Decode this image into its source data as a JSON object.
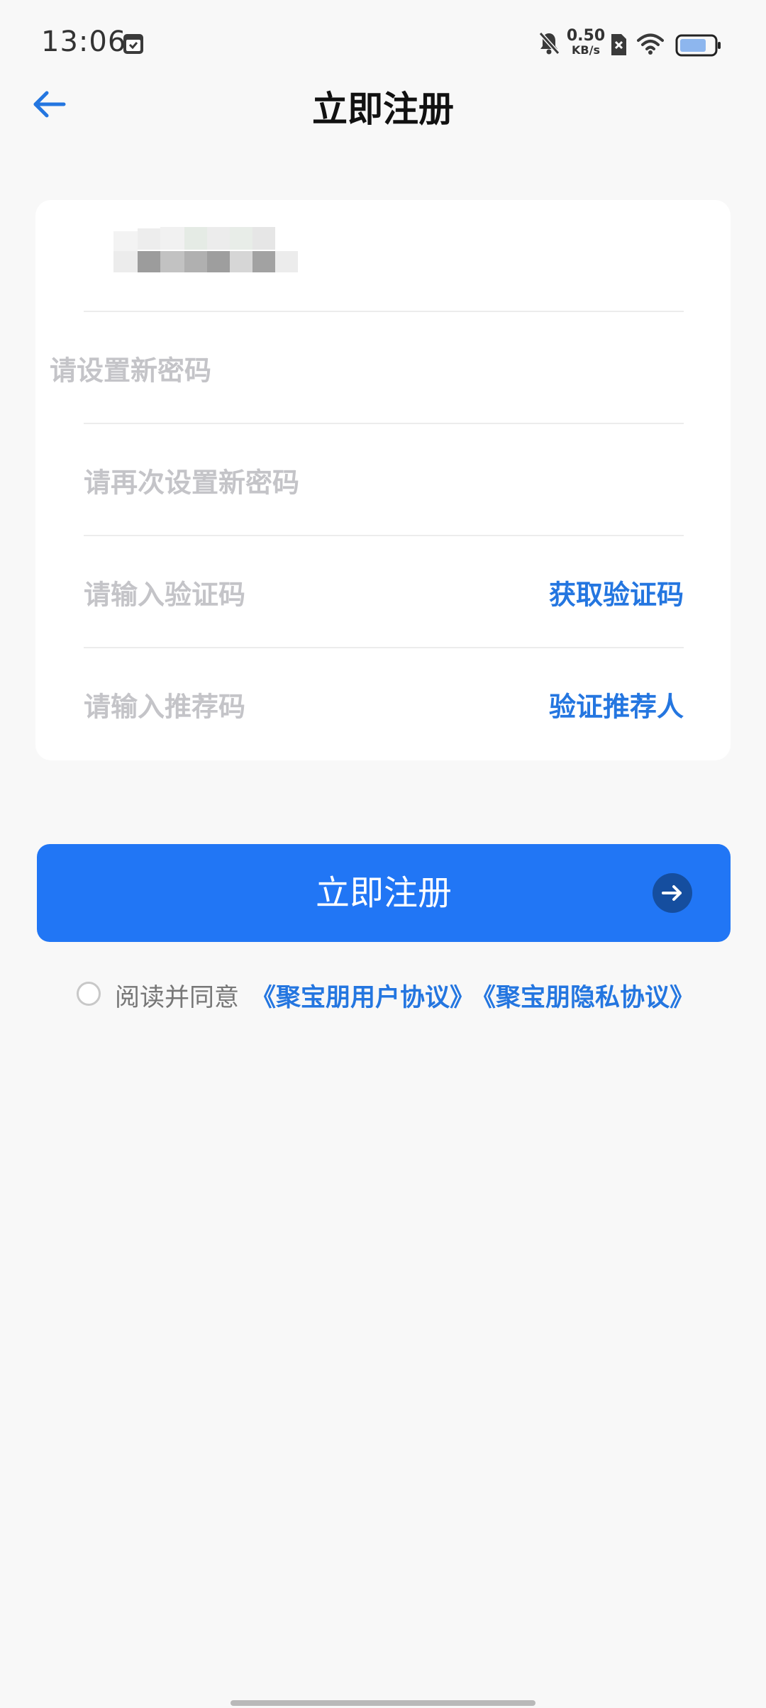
{
  "status_bar": {
    "time": "13:06",
    "net_speed_value": "0.50",
    "net_speed_unit": "KB/s",
    "icons": [
      "calendar-icon",
      "bell-muted-icon",
      "sim-blocked-icon",
      "wifi-icon",
      "battery-icon"
    ]
  },
  "header": {
    "title": "立即注册",
    "back_icon": "arrow-left-icon"
  },
  "form": {
    "phone_value": "",
    "password_placeholder": "请设置新密码",
    "confirm_password_placeholder": "请再次设置新密码",
    "verify_code_placeholder": "请输入验证码",
    "get_code_label": "获取验证码",
    "referral_code_placeholder": "请输入推荐码",
    "verify_referrer_label": "验证推荐人"
  },
  "register_button": {
    "label": "立即注册",
    "icon": "arrow-right-circle-icon"
  },
  "agreement": {
    "prefix": "阅读并同意",
    "user_agreement_label": "《聚宝朋用户协议》",
    "privacy_agreement_label": "《聚宝朋隐私协议》"
  },
  "colors": {
    "accent": "#2176f5",
    "link": "#2476e0",
    "placeholder": "#c4c4c8",
    "background": "#f8f8f8",
    "card": "#ffffff"
  }
}
